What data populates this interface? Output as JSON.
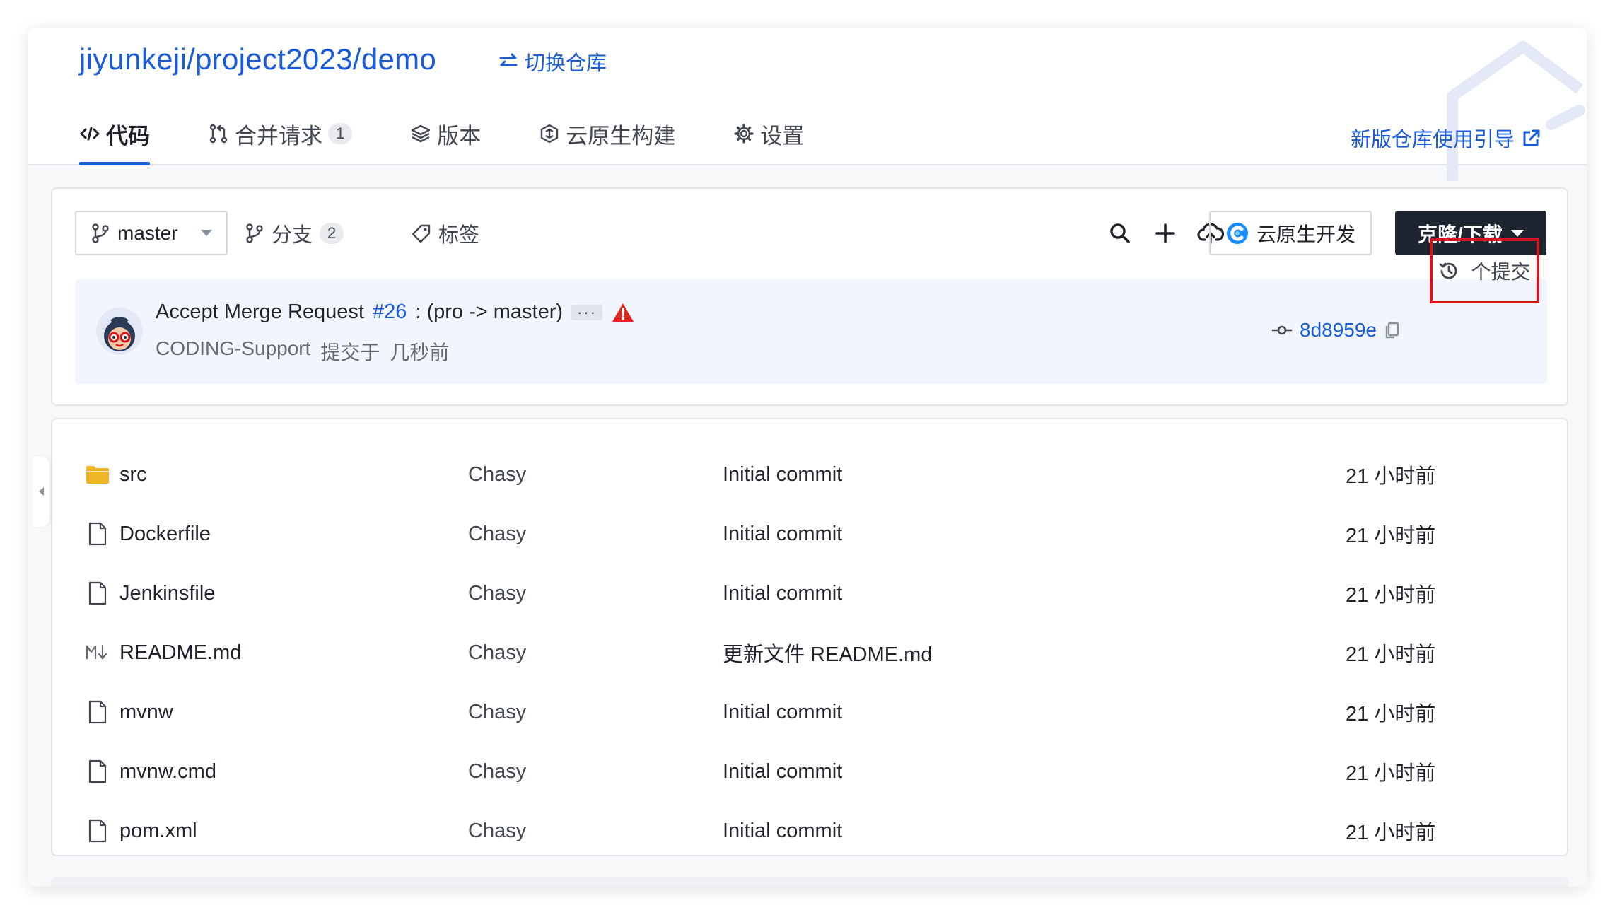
{
  "header": {
    "repo_path": "jiyunkeji/project2023/demo",
    "switch_repo_label": "切换仓库",
    "guide_link_label": "新版仓库使用引导"
  },
  "tabs": [
    {
      "label": "代码",
      "active": true,
      "icon": "code-icon"
    },
    {
      "label": "合并请求",
      "badge": "1",
      "icon": "merge-request-icon"
    },
    {
      "label": "版本",
      "icon": "layers-icon"
    },
    {
      "label": "云原生构建",
      "icon": "build-icon"
    },
    {
      "label": "设置",
      "icon": "gear-icon"
    }
  ],
  "toolbar": {
    "branch": "master",
    "branches_label": "分支",
    "branches_count": "2",
    "tags_label": "标签",
    "cloud_dev_label": "云原生开发",
    "clone_label": "克隆/下载"
  },
  "latest_commit": {
    "message_prefix": "Accept Merge Request",
    "mr_number": "#26",
    "message_suffix": ": (pro -> master)",
    "ellipsis": "···",
    "author": "CODING-Support",
    "action": "提交于",
    "time": "几秒前",
    "hash": "8d8959e",
    "commits_label": "个提交"
  },
  "files": [
    {
      "name": "src",
      "type": "folder",
      "author": "Chasy",
      "message": "Initial commit",
      "time": "21 小时前"
    },
    {
      "name": "Dockerfile",
      "type": "file",
      "author": "Chasy",
      "message": "Initial commit",
      "time": "21 小时前"
    },
    {
      "name": "Jenkinsfile",
      "type": "file",
      "author": "Chasy",
      "message": "Initial commit",
      "time": "21 小时前"
    },
    {
      "name": "README.md",
      "type": "markdown",
      "author": "Chasy",
      "message": "更新文件 README.md",
      "time": "21 小时前"
    },
    {
      "name": "mvnw",
      "type": "file",
      "author": "Chasy",
      "message": "Initial commit",
      "time": "21 小时前"
    },
    {
      "name": "mvnw.cmd",
      "type": "file",
      "author": "Chasy",
      "message": "Initial commit",
      "time": "21 小时前"
    },
    {
      "name": "pom.xml",
      "type": "file",
      "author": "Chasy",
      "message": "Initial commit",
      "time": "21 小时前"
    }
  ],
  "colors": {
    "accent": "#1a5bd8",
    "clone_button": "#1d2530",
    "highlight_box": "#d6141e",
    "warning": "#e0251c",
    "folder": "#f0b429"
  }
}
